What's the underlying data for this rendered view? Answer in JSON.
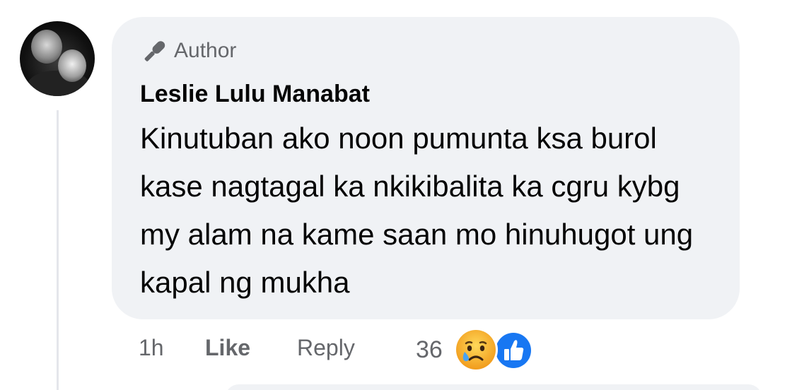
{
  "comment": {
    "badge": {
      "icon": "microphone-icon",
      "label": "Author"
    },
    "author_name": "Leslie Lulu Manabat",
    "text": "Kinutuban ako noon pumunta ksa burol kase nagtagal ka nkikibalita ka cgru kybg my alam na kame saan mo hinuhugot ung kapal ng mukha",
    "time": "1h",
    "like_label": "Like",
    "reply_label": "Reply",
    "reaction_count": "36",
    "reactions": [
      "sad-reaction-icon",
      "like-reaction-icon"
    ]
  },
  "colors": {
    "bubble": "#f0f2f5",
    "secondary_text": "#65676b",
    "primary_text": "#050505",
    "like_blue": "#1877f2",
    "sad_yellow": "#f7b125"
  }
}
